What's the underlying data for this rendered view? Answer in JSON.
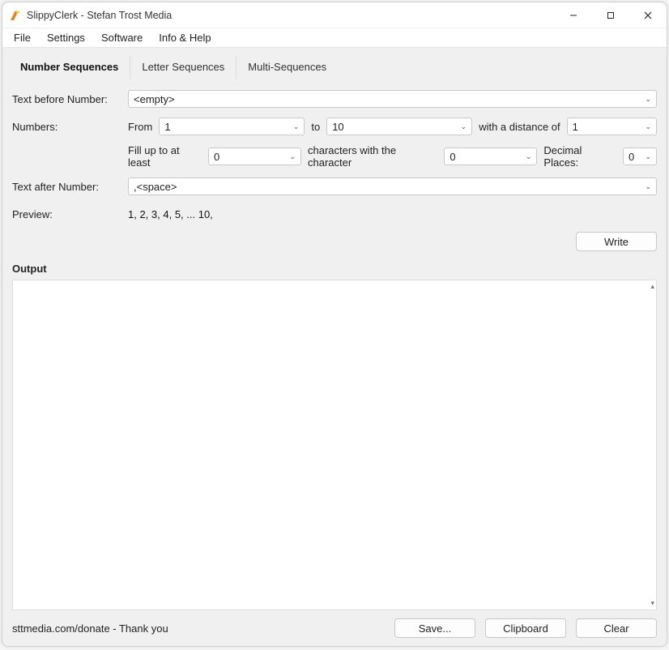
{
  "window": {
    "title": "SlippyClerk - Stefan Trost Media"
  },
  "menu": {
    "file": "File",
    "settings": "Settings",
    "software": "Software",
    "info_help": "Info & Help"
  },
  "tabs": {
    "number_sequences": "Number Sequences",
    "letter_sequences": "Letter Sequences",
    "multi_sequences": "Multi-Sequences"
  },
  "form": {
    "text_before_label": "Text before Number:",
    "text_before_value": "<empty>",
    "numbers_label": "Numbers:",
    "from_label": "From",
    "from_value": "1",
    "to_label": "to",
    "to_value": "10",
    "distance_label": "with a distance of",
    "distance_value": "1",
    "fillup_label": "Fill up to at least",
    "fillup_value": "0",
    "chars_with_label": "characters with the character",
    "fill_char_value": "0",
    "decimal_places_label": "Decimal Places:",
    "decimal_places_value": "0",
    "text_after_label": "Text after Number:",
    "text_after_value": ",<space>",
    "preview_label": "Preview:",
    "preview_value": "1, 2, 3, 4, 5, ... 10,",
    "write_button": "Write"
  },
  "output": {
    "label": "Output"
  },
  "footer": {
    "status": "sttmedia.com/donate - Thank you",
    "save": "Save...",
    "clipboard": "Clipboard",
    "clear": "Clear"
  }
}
